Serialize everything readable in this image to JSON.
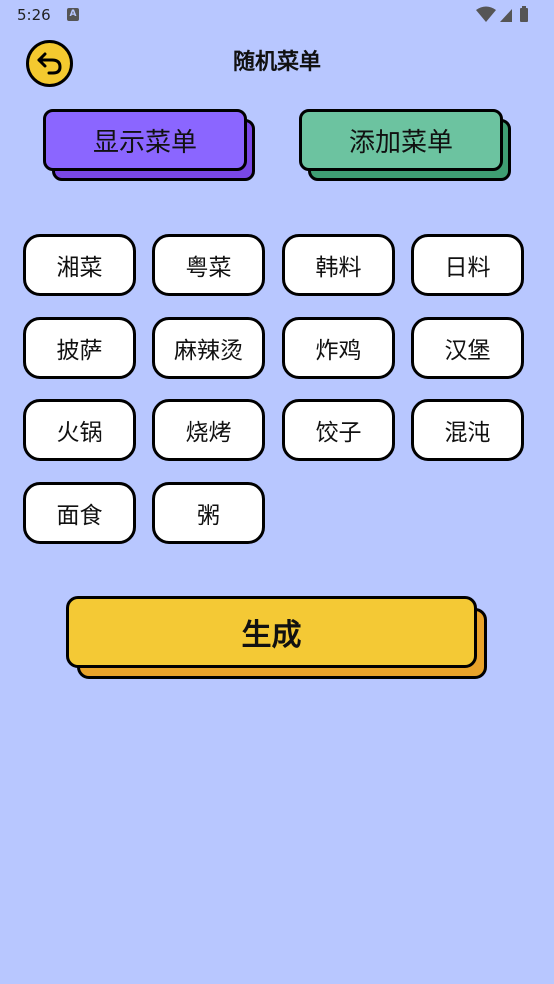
{
  "status": {
    "time": "5:26"
  },
  "header": {
    "title": "随机菜单"
  },
  "buttons": {
    "show_menu": "显示菜单",
    "add_menu": "添加菜单",
    "generate": "生成"
  },
  "tags": [
    "湘菜",
    "粤菜",
    "韩料",
    "日料",
    "披萨",
    "麻辣烫",
    "炸鸡",
    "汉堡",
    "火锅",
    "烧烤",
    "饺子",
    "混沌",
    "面食",
    "粥"
  ],
  "colors": {
    "background": "#b8c7ff",
    "accent_yellow": "#f4c935",
    "purple": "#8b66ff",
    "green": "#6cc3a0"
  }
}
